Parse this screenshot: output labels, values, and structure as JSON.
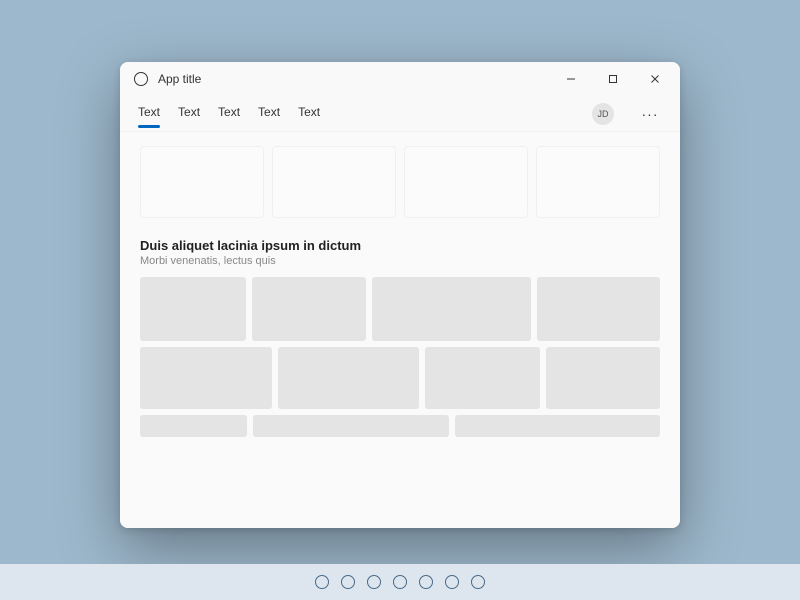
{
  "window": {
    "title": "App title"
  },
  "tabs": [
    {
      "label": "Text",
      "active": true
    },
    {
      "label": "Text",
      "active": false
    },
    {
      "label": "Text",
      "active": false
    },
    {
      "label": "Text",
      "active": false
    },
    {
      "label": "Text",
      "active": false
    }
  ],
  "user": {
    "initials": "JD"
  },
  "section": {
    "title": "Duis aliquet lacinia ipsum in dictum",
    "subtitle": "Morbi venenatis, lectus quis"
  },
  "taskbar": {
    "icon_count": 7
  }
}
